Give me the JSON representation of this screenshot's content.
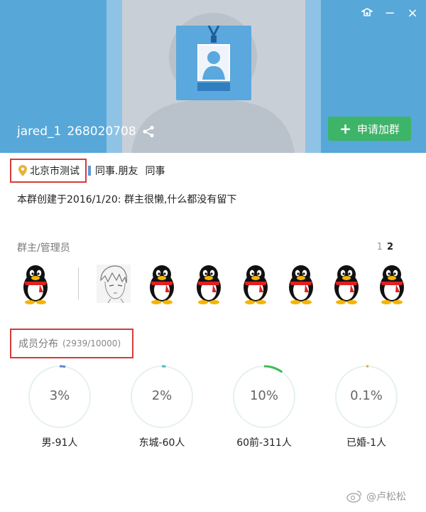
{
  "window": {
    "controls": [
      "settings-icon",
      "minimize-icon",
      "close-icon"
    ],
    "minimize_glyph": "−",
    "close_glyph": "×"
  },
  "header": {
    "group_name": "jared_1",
    "group_id": "268020708",
    "apply_label": "申请加群",
    "apply_icon": "+",
    "colors": {
      "banner": "#57a7d8",
      "apply_button": "#3db468"
    }
  },
  "tags": {
    "location": "北京市测试",
    "items": [
      "同事.朋友",
      "同事"
    ]
  },
  "description": "本群创建于2016/1/20:  群主很懒,什么都没有留下",
  "admins": {
    "label": "群主/管理员",
    "pages": [
      "1",
      "2"
    ],
    "current_page": "2",
    "members": [
      "qq-penguin-icon",
      "anime-avatar",
      "qq-penguin-icon",
      "qq-penguin-icon",
      "qq-penguin-icon",
      "qq-penguin-icon",
      "qq-penguin-icon",
      "qq-penguin-icon"
    ]
  },
  "distribution": {
    "label": "成员分布",
    "count": "(2939/10000)",
    "stats": [
      {
        "percent": "3%",
        "fraction": 0.03,
        "label": "男-91人",
        "color": "#5b86d6"
      },
      {
        "percent": "2%",
        "fraction": 0.02,
        "label": "东城-60人",
        "color": "#52b9c9"
      },
      {
        "percent": "10%",
        "fraction": 0.1,
        "label": "60前-311人",
        "color": "#3dbb55"
      },
      {
        "percent": "0.1%",
        "fraction": 0.001,
        "label": "已婚-1人",
        "color": "#e6a23c"
      }
    ]
  },
  "watermark": {
    "text": "@卢松松"
  }
}
